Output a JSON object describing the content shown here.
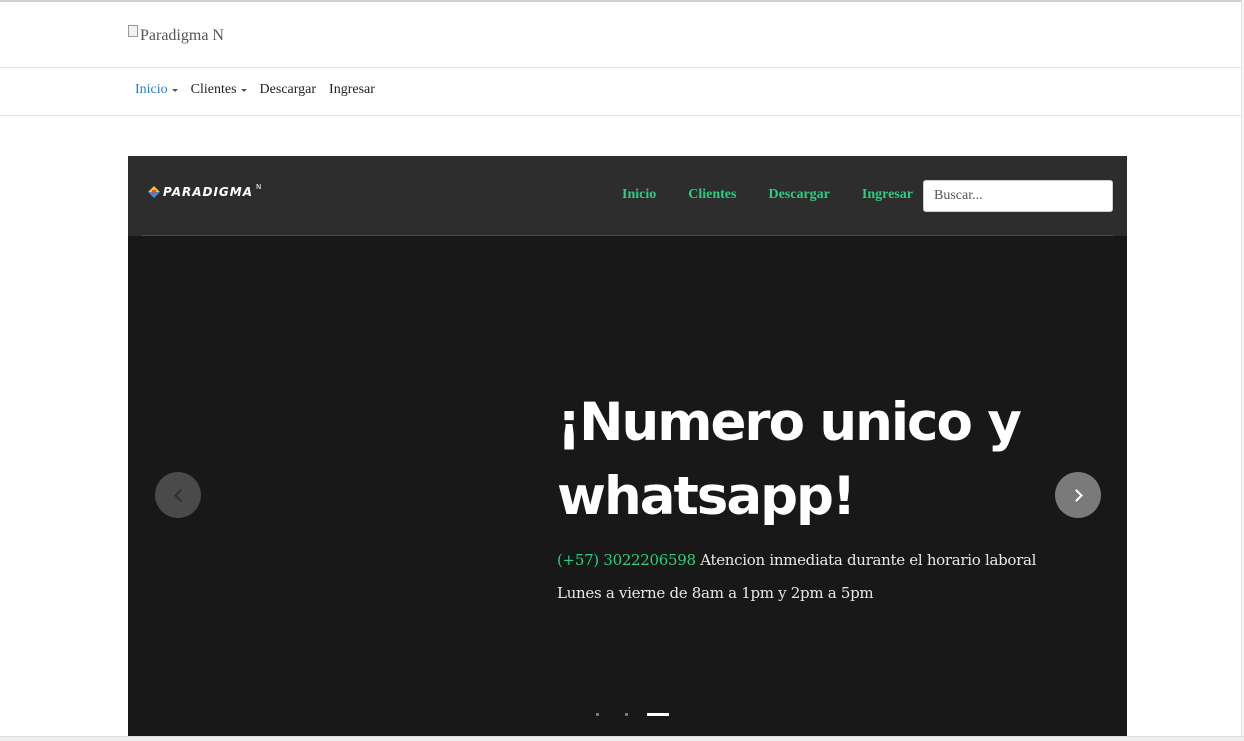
{
  "logo_bar": {
    "logo_alt": "Paradigma N"
  },
  "nav": {
    "items": [
      {
        "label": "Inicio",
        "active": true,
        "dropdown": true
      },
      {
        "label": "Clientes",
        "active": false,
        "dropdown": true
      },
      {
        "label": "Descargar",
        "active": false,
        "dropdown": false
      },
      {
        "label": "Ingresar",
        "active": false,
        "dropdown": false
      }
    ]
  },
  "site": {
    "brand_text": "PARADIGMA",
    "brand_sup": "N",
    "menu": [
      "Inicio",
      "Clientes",
      "Descargar",
      "Ingresar"
    ],
    "search_placeholder": "Buscar...",
    "accent_color": "#2ecc80",
    "header_bg": "#2d2d2d",
    "slide_bg": "#181818"
  },
  "slide": {
    "headline": "¡Numero unico y whatsapp!",
    "phone": "(+57) 3022206598",
    "line1_rest": " Atencion inmediata durante el horario laboral",
    "line2": "Lunes a vierne de 8am a 1pm y 2pm a 5pm",
    "prev_icon": "chevron-left-icon",
    "next_icon": "chevron-right-icon",
    "indicator_count": 3,
    "active_indicator": 3
  }
}
